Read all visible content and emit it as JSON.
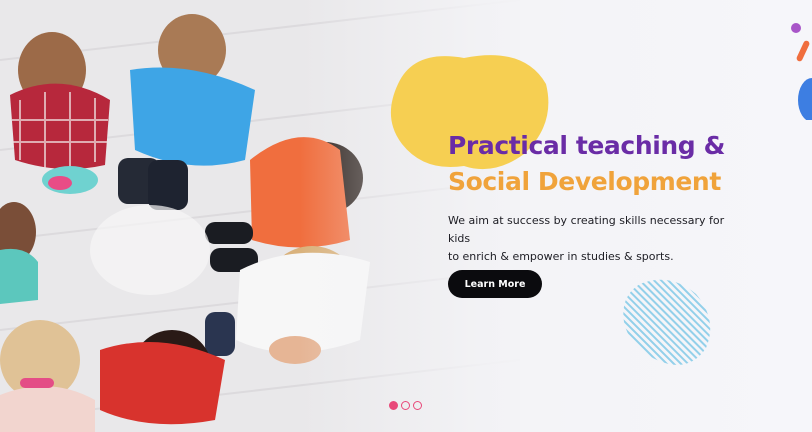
{
  "hero": {
    "headline_line1": "Practical teaching &",
    "headline_line2": "Social Development",
    "description_line1": "We aim at success by creating skills necessary for kids",
    "description_line2": "to enrich & empower in studies & sports.",
    "cta_label": "Learn More",
    "photo_description": "Overhead photo of children standing in a circle holding each other"
  },
  "slider": {
    "slide_count": 3,
    "active_index": 0
  },
  "colors": {
    "headline_purple": "#6a2ca6",
    "headline_orange": "#f0a33b",
    "button_bg": "#0b0b0e",
    "blob_yellow": "#f6cf52",
    "stripe_blue": "#7ac7e6",
    "dot_pink": "#e8497a"
  },
  "icons": [
    "yellow-blob-shape",
    "striped-blob-shape",
    "dot-indicator"
  ]
}
